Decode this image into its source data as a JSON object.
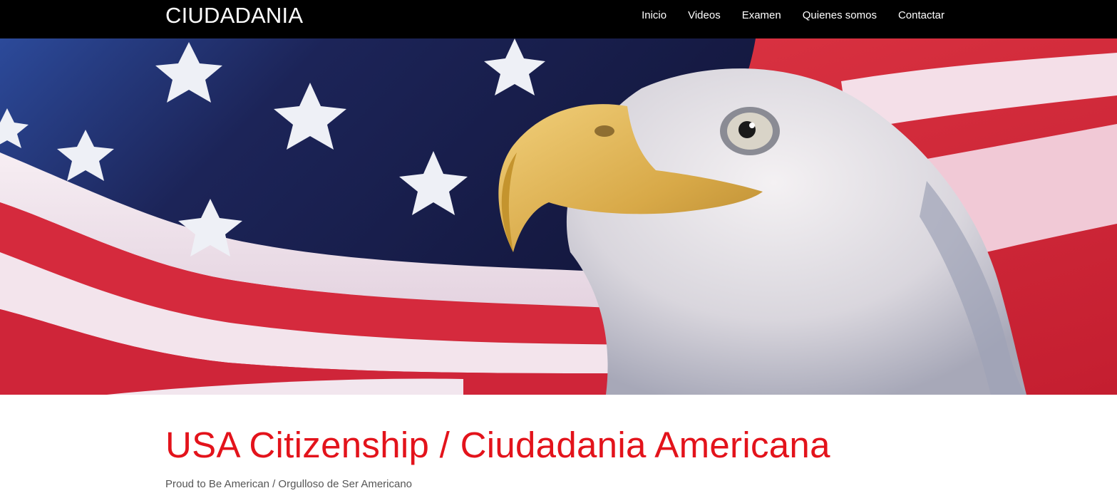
{
  "header": {
    "brand": "CIUDADANIA",
    "nav": [
      {
        "label": "Inicio"
      },
      {
        "label": "Videos"
      },
      {
        "label": "Examen"
      },
      {
        "label": "Quienes somos"
      },
      {
        "label": "Contactar"
      }
    ]
  },
  "hero": {
    "image": "american-flag-and-bald-eagle"
  },
  "main": {
    "title": "USA Citizenship / Ciudadania Americana",
    "subtitle": "Proud to Be American / Orgulloso de Ser Americano"
  },
  "colors": {
    "header_bg": "#000000",
    "title": "#e3131b",
    "subtitle": "#555555",
    "flag_red": "#d8283a",
    "flag_blue": "#1f2b6b"
  }
}
